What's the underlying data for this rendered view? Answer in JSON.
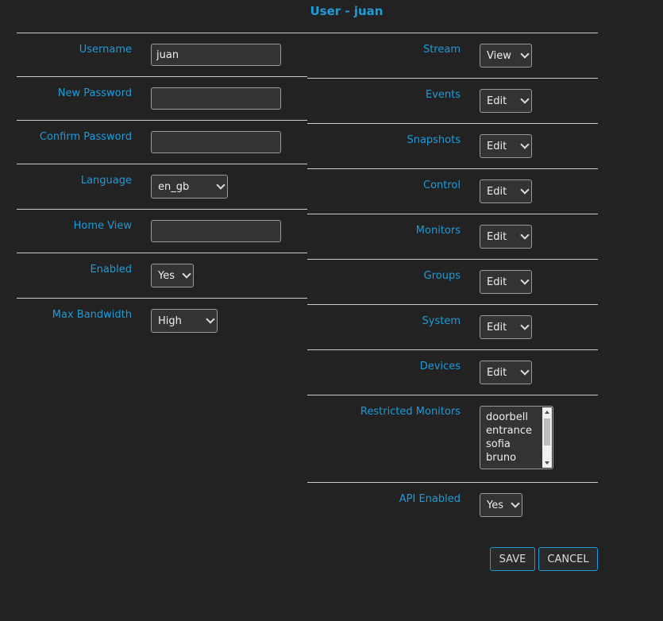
{
  "title": "User - juan",
  "left": {
    "username": {
      "label": "Username",
      "value": "juan"
    },
    "new_password": {
      "label": "New Password",
      "value": ""
    },
    "confirm_password": {
      "label": "Confirm Password",
      "value": ""
    },
    "language": {
      "label": "Language",
      "value": "en_gb"
    },
    "home_view": {
      "label": "Home View",
      "value": ""
    },
    "enabled": {
      "label": "Enabled",
      "value": "Yes"
    },
    "max_bandwidth": {
      "label": "Max Bandwidth",
      "value": "High"
    }
  },
  "right": {
    "stream": {
      "label": "Stream",
      "value": "View"
    },
    "events": {
      "label": "Events",
      "value": "Edit"
    },
    "snapshots": {
      "label": "Snapshots",
      "value": "Edit"
    },
    "control": {
      "label": "Control",
      "value": "Edit"
    },
    "monitors": {
      "label": "Monitors",
      "value": "Edit"
    },
    "groups": {
      "label": "Groups",
      "value": "Edit"
    },
    "system": {
      "label": "System",
      "value": "Edit"
    },
    "devices": {
      "label": "Devices",
      "value": "Edit"
    },
    "restricted_monitors": {
      "label": "Restricted Monitors",
      "options": [
        "doorbell",
        "entrance",
        "sofia",
        "bruno"
      ]
    },
    "api_enabled": {
      "label": "API Enabled",
      "value": "Yes"
    }
  },
  "actions": {
    "save_label": "SAVE",
    "cancel_label": "CANCEL"
  },
  "colors": {
    "accent": "#1e9bd9",
    "background": "#222222",
    "field": "#333333"
  }
}
